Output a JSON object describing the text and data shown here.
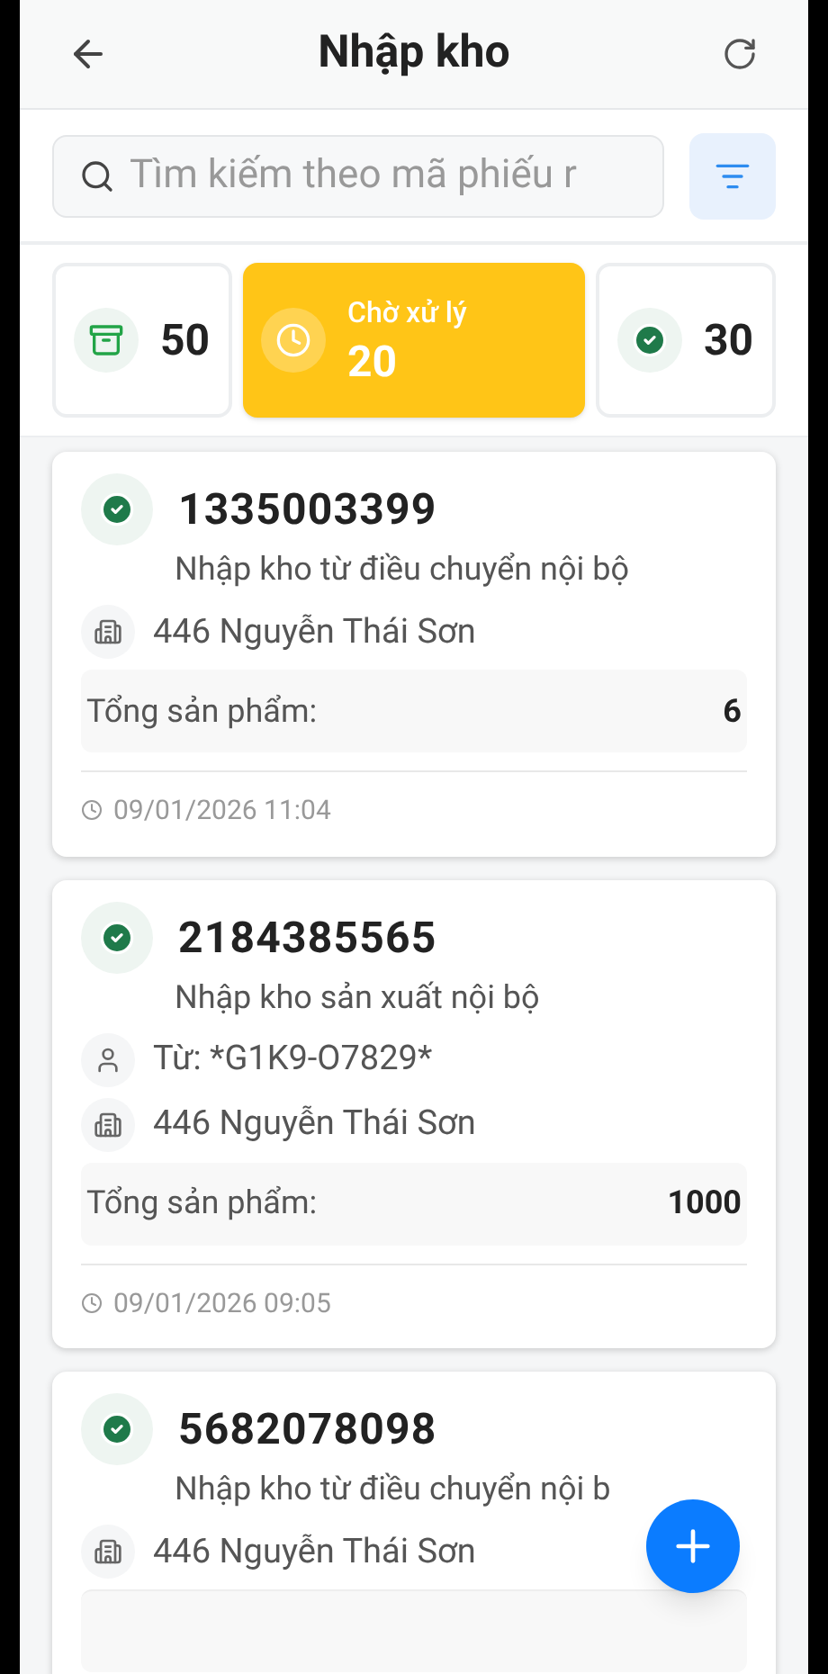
{
  "header": {
    "title": "Nhập kho"
  },
  "search": {
    "placeholder": "Tìm kiếm theo mã phiếu r"
  },
  "stats": [
    {
      "kind": "archive",
      "count": "50",
      "selected": false
    },
    {
      "kind": "pending",
      "label": "Chờ xử lý",
      "count": "20",
      "selected": true
    },
    {
      "kind": "done",
      "count": "30",
      "selected": false
    }
  ],
  "receipts": [
    {
      "code": "1335003399",
      "type": "Nhập kho từ điều chuyển nội bộ",
      "address": "446 Nguyễn Thái Sơn",
      "total_label": "Tổng sản phẩm:",
      "total": "6",
      "time": "09/01/2026 11:04"
    },
    {
      "code": "2184385565",
      "type": "Nhập kho sản xuất nội bộ",
      "from": "Từ: *G1K9-O7829*",
      "address": "446 Nguyễn Thái Sơn",
      "total_label": "Tổng sản phẩm:",
      "total": "1000",
      "time": "09/01/2026 09:05"
    },
    {
      "code": "5682078098",
      "type": "Nhập kho từ điều chuyển nội b",
      "address": "446 Nguyễn Thái Sơn"
    }
  ]
}
